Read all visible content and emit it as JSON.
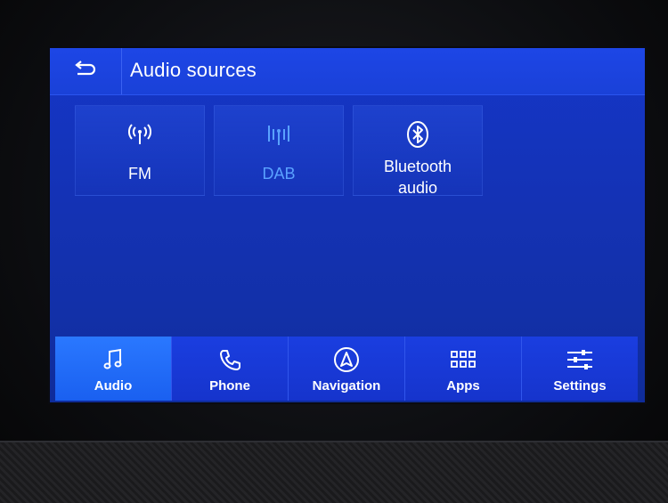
{
  "header": {
    "title": "Audio sources",
    "back_icon": "back-arrow-icon"
  },
  "sources": [
    {
      "label": "FM",
      "icon": "radio-antenna-icon",
      "active": false
    },
    {
      "label": "DAB",
      "icon": "dab-signal-icon",
      "active": true
    },
    {
      "label": "Bluetooth\naudio",
      "icon": "bluetooth-icon",
      "active": false
    }
  ],
  "nav": [
    {
      "label": "Audio",
      "icon": "music-note-icon",
      "active": true
    },
    {
      "label": "Phone",
      "icon": "phone-icon",
      "active": false
    },
    {
      "label": "Navigation",
      "icon": "compass-icon",
      "active": false
    },
    {
      "label": "Apps",
      "icon": "apps-grid-icon",
      "active": false
    },
    {
      "label": "Settings",
      "icon": "sliders-icon",
      "active": false
    }
  ],
  "colors": {
    "screen_bg": "#1432b4",
    "active_accent": "#5aa2ff",
    "nav_active": "#2a78ff"
  }
}
